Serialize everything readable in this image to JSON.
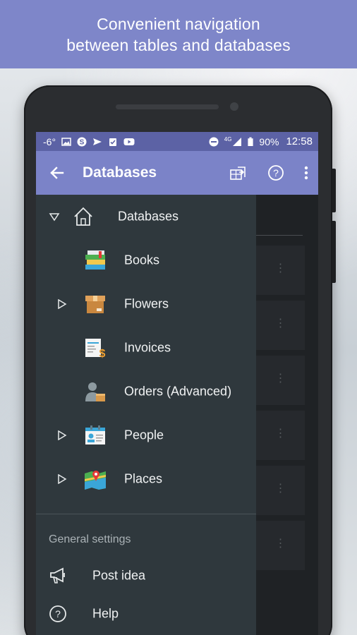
{
  "banner": {
    "line1": "Convenient navigation",
    "line2": "between tables and databases"
  },
  "status_bar": {
    "temperature": "-6°",
    "network": "4G",
    "battery": "90%",
    "time": "12:58",
    "left_icons": [
      "image-icon",
      "skype-icon",
      "send-icon",
      "clipboard-check-icon",
      "youtube-icon"
    ],
    "right_icons": [
      "do-not-disturb-icon",
      "signal-icon",
      "battery-icon"
    ]
  },
  "app_bar": {
    "title": "Databases",
    "icons": [
      "back-arrow-icon",
      "share-table-icon",
      "help-icon",
      "overflow-menu-icon"
    ]
  },
  "drawer": {
    "root": {
      "label": "Databases",
      "icon": "home-icon",
      "expanded": true
    },
    "items": [
      {
        "label": "Books",
        "icon": "books-icon",
        "expandable": false
      },
      {
        "label": "Flowers",
        "icon": "box-icon",
        "expandable": true
      },
      {
        "label": "Invoices",
        "icon": "invoice-icon",
        "expandable": false
      },
      {
        "label": "Orders (Advanced)",
        "icon": "orders-person-icon",
        "expandable": false
      },
      {
        "label": "People",
        "icon": "id-card-icon",
        "expandable": true
      },
      {
        "label": "Places",
        "icon": "map-icon",
        "expandable": true
      }
    ],
    "section_title": "General settings",
    "menu": [
      {
        "label": "Post idea",
        "icon": "megaphone-icon"
      },
      {
        "label": "Help",
        "icon": "help-circle-icon"
      }
    ]
  },
  "colors": {
    "banner": "#7e86c9",
    "status_bar": "#5c62a5",
    "app_bar": "#7b83c8",
    "drawer": "#2f383d",
    "background": "#1f2225"
  }
}
